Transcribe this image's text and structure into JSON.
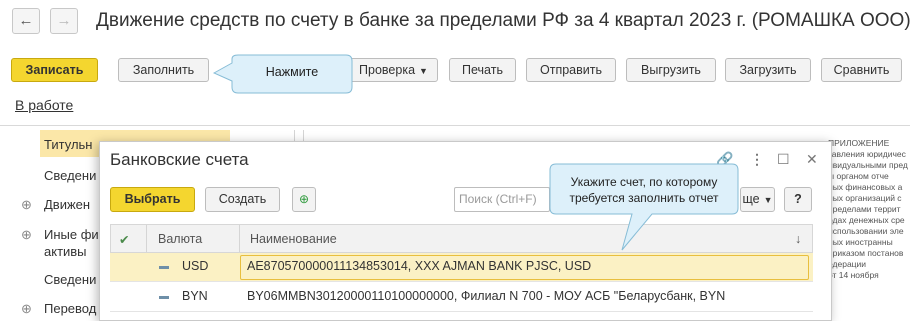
{
  "nav": {
    "back_glyph": "←",
    "forward_glyph": "→"
  },
  "window_title": "Движение средств по счету в банке за пределами РФ за 4 квартал 2023 г. (РОМАШКА ООО) *",
  "toolbar": {
    "write_label": "Записать",
    "fill_label": "Заполнить",
    "check_label": "Проверка",
    "print_label": "Печать",
    "send_label": "Отправить",
    "export_label": "Выгрузить",
    "import_label": "Загрузить",
    "compare_label": "Сравнить"
  },
  "callout_fill": "Нажмите",
  "status_link": "В работе",
  "sidebar": {
    "items": [
      {
        "label": "Титульн",
        "selected": true
      },
      {
        "label": "Сведени"
      },
      {
        "label": "Движен",
        "expandable": true
      },
      {
        "label": "Иные фи",
        "expandable": true
      },
      {
        "label": "активы"
      },
      {
        "label": "Сведени"
      },
      {
        "label": "Перевод",
        "expandable": true
      }
    ]
  },
  "right_panel_lines": [
    "ПРИЛОЖЕНИЕ",
    "тавления юридичес",
    "ивидуальными пред",
    "ы органом отче",
    "ных финансовых а",
    "ных организаций с",
    "пределами террит",
    "одах денежных сре",
    "использовании эле",
    "ных иностранны",
    "приказом постанов",
    "едерации",
    "от 14 ноября"
  ],
  "dialog": {
    "title": "Банковские счета",
    "select_label": "Выбрать",
    "create_label": "Создать",
    "search_placeholder": "Поиск (Ctrl+F)",
    "more_label": "ще",
    "help_label": "?",
    "callout": "Укажите счет, по которому требуется заполнить отчет",
    "columns": {
      "check": "✔",
      "currency": "Валюта",
      "name": "Наименование",
      "sort_glyph": "↓"
    },
    "rows": [
      {
        "currency": "USD",
        "name": "AE870570000011134853014, XXX AJMAN BANK PJSC, USD",
        "selected": true
      },
      {
        "currency": "BYN",
        "name": "BY06MMBN30120000110100000000, Филиал N 700 - МОУ АСБ \"Беларусбанк, BYN"
      }
    ]
  },
  "colors": {
    "accent_yellow": "#f4d62f",
    "callout_bg": "#ddf0fa",
    "selected_row": "#fbf1c4",
    "sidebar_selected": "#fbe7a8"
  },
  "icons": [
    "back-arrow-icon",
    "forward-arrow-icon",
    "link-icon",
    "more-icon",
    "maximize-icon",
    "close-icon",
    "add-copy-icon",
    "caret-down-icon"
  ]
}
